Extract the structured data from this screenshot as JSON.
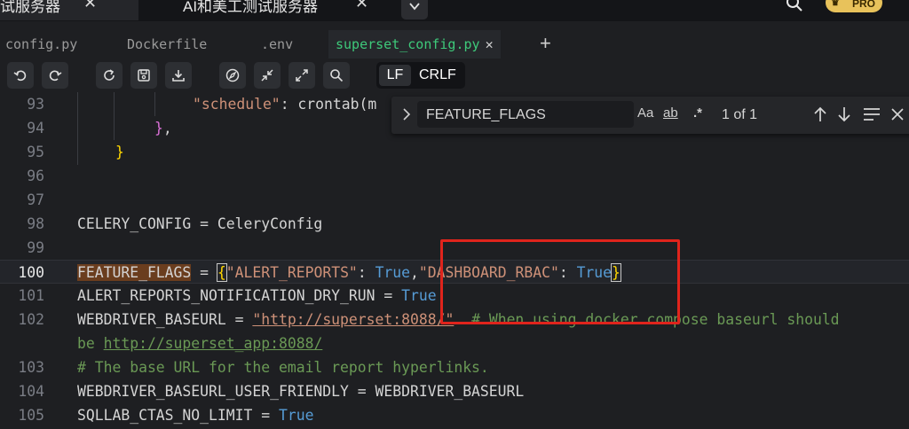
{
  "window_tabs": [
    {
      "label": "试服务器",
      "close": "✕"
    },
    {
      "label": "AI和美工测试服务器",
      "close": "✕"
    }
  ],
  "pro_badge": "PRO",
  "file_tabs": [
    {
      "label": "config.py"
    },
    {
      "label": "Dockerfile"
    },
    {
      "label": ".env"
    },
    {
      "label": "superset_config.py",
      "close": "✕"
    }
  ],
  "new_tab": "+",
  "eol": {
    "lf": "LF",
    "crlf": "CRLF"
  },
  "find": {
    "query": "FEATURE_FLAGS",
    "match_case": "Aa",
    "whole_word": "ab",
    "regex": ".*",
    "count": "1 of 1"
  },
  "lines": [
    {
      "num": "93",
      "tokens": [
        [
          "k-str",
          "\"schedule\""
        ],
        [
          "k-id",
          ": crontab("
        ],
        [
          "k-id",
          "m"
        ]
      ]
    },
    {
      "num": "94",
      "tokens": [
        [
          "k-br2",
          "}"
        ],
        [
          "k-id",
          ","
        ]
      ]
    },
    {
      "num": "95",
      "tokens": [
        [
          "k-br1",
          "}"
        ]
      ]
    },
    {
      "num": "96",
      "tokens": []
    },
    {
      "num": "97",
      "tokens": []
    },
    {
      "num": "98",
      "tokens": [
        [
          "k-id",
          "CELERY_CONFIG = CeleryConfig"
        ]
      ]
    },
    {
      "num": "99",
      "tokens": []
    },
    {
      "num": "100",
      "tokens": [
        [
          "hl-find",
          "FEATURE_FLAGS"
        ],
        [
          "k-id",
          " = "
        ],
        [
          "k-br1 hl-bracket",
          "{"
        ],
        [
          "k-str",
          "\"ALERT_REPORTS\""
        ],
        [
          "k-id",
          ": "
        ],
        [
          "k-true",
          "True"
        ],
        [
          "k-id",
          ","
        ],
        [
          "k-str",
          "\"DASHBOARD_RBAC\""
        ],
        [
          "k-id",
          ": "
        ],
        [
          "k-true",
          "True"
        ],
        [
          "k-br1 hl-bracket",
          "}"
        ]
      ]
    },
    {
      "num": "101",
      "tokens": [
        [
          "k-id",
          "ALERT_REPORTS_NOTIFICATION_DRY_RUN = "
        ],
        [
          "k-true",
          "True"
        ]
      ]
    },
    {
      "num": "102",
      "tokens": [
        [
          "k-id",
          "WEBDRIVER_BASEURL = "
        ],
        [
          "k-url",
          "\"http://superset:8088/\""
        ],
        [
          "k-id",
          "  "
        ],
        [
          "k-com",
          "# When using docker compose baseurl should"
        ]
      ]
    },
    {
      "num": "",
      "tokens": [
        [
          "k-com",
          "be "
        ],
        [
          "k-url2",
          "http://superset_app:8088/"
        ]
      ]
    },
    {
      "num": "103",
      "tokens": [
        [
          "k-com",
          "# The base URL for the email report hyperlinks."
        ]
      ]
    },
    {
      "num": "104",
      "tokens": [
        [
          "k-id",
          "WEBDRIVER_BASEURL_USER_FRIENDLY = WEBDRIVER_BASEURL"
        ]
      ]
    },
    {
      "num": "105",
      "tokens": [
        [
          "k-id",
          "SQLLAB_CTAS_NO_LIMIT = "
        ],
        [
          "k-true",
          "True"
        ]
      ]
    }
  ]
}
